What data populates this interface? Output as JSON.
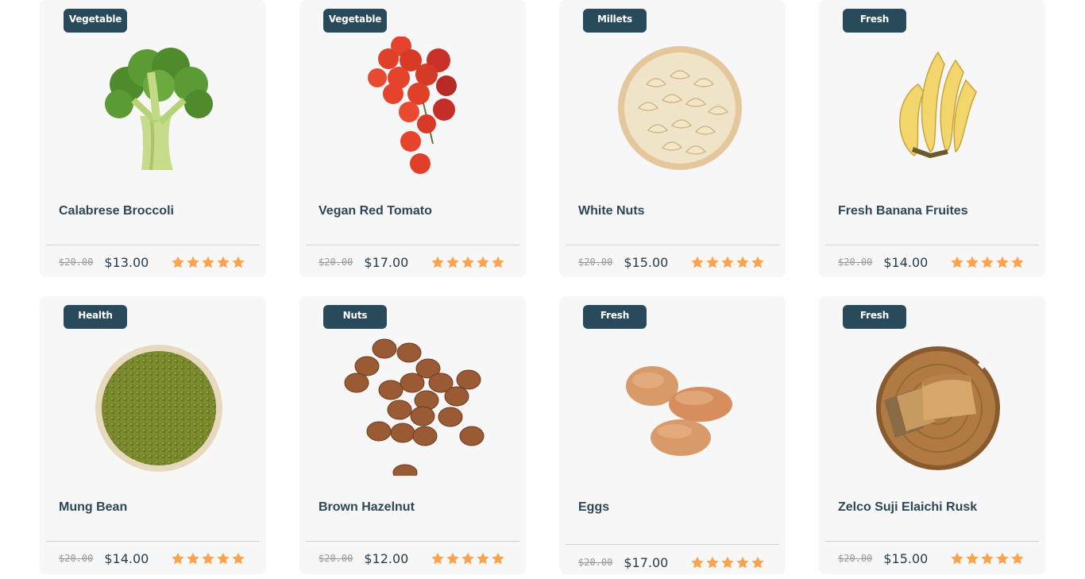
{
  "colors": {
    "badge_bg": "#294a5a",
    "card_bg": "#f7f7f7",
    "title": "#2d4756",
    "star": "#fda34e"
  },
  "products": [
    {
      "badge": "Vegetable",
      "title": "Calabrese Broccoli",
      "old_price": "$20.00",
      "price": "$13.00",
      "rating": 5,
      "image": "broccoli"
    },
    {
      "badge": "Vegetable",
      "title": "Vegan Red Tomato",
      "old_price": "$20.00",
      "price": "$17.00",
      "rating": 5,
      "image": "cherry-tomatoes"
    },
    {
      "badge": "Millets",
      "title": "White Nuts",
      "old_price": "$20.00",
      "price": "$15.00",
      "rating": 5,
      "image": "cashew-bowl"
    },
    {
      "badge": "Fresh",
      "title": "Fresh Banana Fruites",
      "old_price": "$20.00",
      "price": "$14.00",
      "rating": 5,
      "image": "bananas"
    },
    {
      "badge": "Health",
      "title": "Mung Bean",
      "old_price": "$20.00",
      "price": "$14.00",
      "rating": 5,
      "image": "mung-bean-bowl"
    },
    {
      "badge": "Nuts",
      "title": "Brown Hazelnut",
      "old_price": "$20.00",
      "price": "$12.00",
      "rating": 5,
      "image": "hazelnuts"
    },
    {
      "badge": "Fresh",
      "title": "Eggs",
      "old_price": "$20.00",
      "price": "$17.00",
      "rating": 5,
      "image": "eggs"
    },
    {
      "badge": "Fresh",
      "title": "Zelco Suji Elaichi Rusk",
      "old_price": "$20.00",
      "price": "$15.00",
      "rating": 5,
      "image": "rusk-board"
    }
  ]
}
